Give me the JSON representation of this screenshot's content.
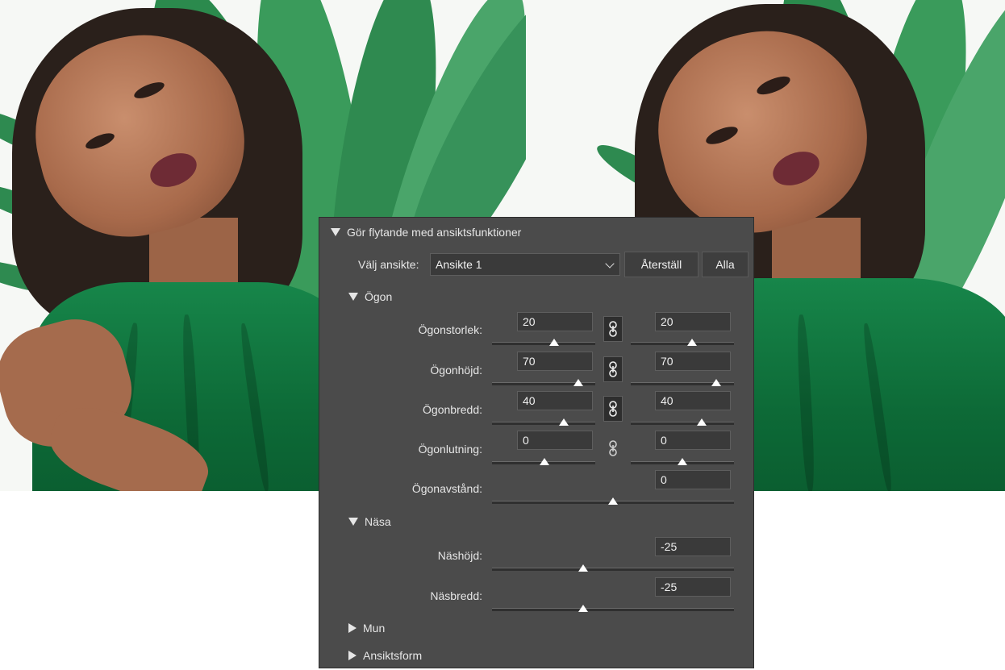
{
  "images": {
    "before": "portrait-before",
    "after": "portrait-after"
  },
  "panel": {
    "header": "Gör flytande med ansiktsfunktioner",
    "select_face": {
      "label": "Välj ansikte:",
      "value": "Ansikte 1"
    },
    "buttons": {
      "reset": "Återställ",
      "all": "Alla"
    },
    "eyes": {
      "title": "Ögon",
      "size": {
        "label": "Ögonstorlek:",
        "left": "20",
        "right": "20",
        "linked": true,
        "left_fraction": 0.6,
        "right_fraction": 0.6
      },
      "height": {
        "label": "Ögonhöjd:",
        "left": "70",
        "right": "70",
        "linked": true,
        "left_fraction": 0.85,
        "right_fraction": 0.85
      },
      "width": {
        "label": "Ögonbredd:",
        "left": "40",
        "right": "40",
        "linked": true,
        "left_fraction": 0.7,
        "right_fraction": 0.7
      },
      "tilt": {
        "label": "Ögonlutning:",
        "left": "0",
        "right": "0",
        "linked": false,
        "left_fraction": 0.5,
        "right_fraction": 0.5
      },
      "distance": {
        "label": "Ögonavstånd:",
        "value": "0",
        "fraction": 0.5
      }
    },
    "nose": {
      "title": "Näsa",
      "height": {
        "label": "Näshöjd:",
        "value": "-25",
        "fraction": 0.375
      },
      "width": {
        "label": "Näsbredd:",
        "value": "-25",
        "fraction": 0.375
      }
    },
    "mouth": {
      "title": "Mun"
    },
    "face_shape": {
      "title": "Ansiktsform"
    }
  },
  "icons": {
    "collapse": "triangle-down-icon",
    "expand": "triangle-right-icon",
    "link": "chain-link-icon",
    "dropdown": "chevron-down-icon"
  }
}
